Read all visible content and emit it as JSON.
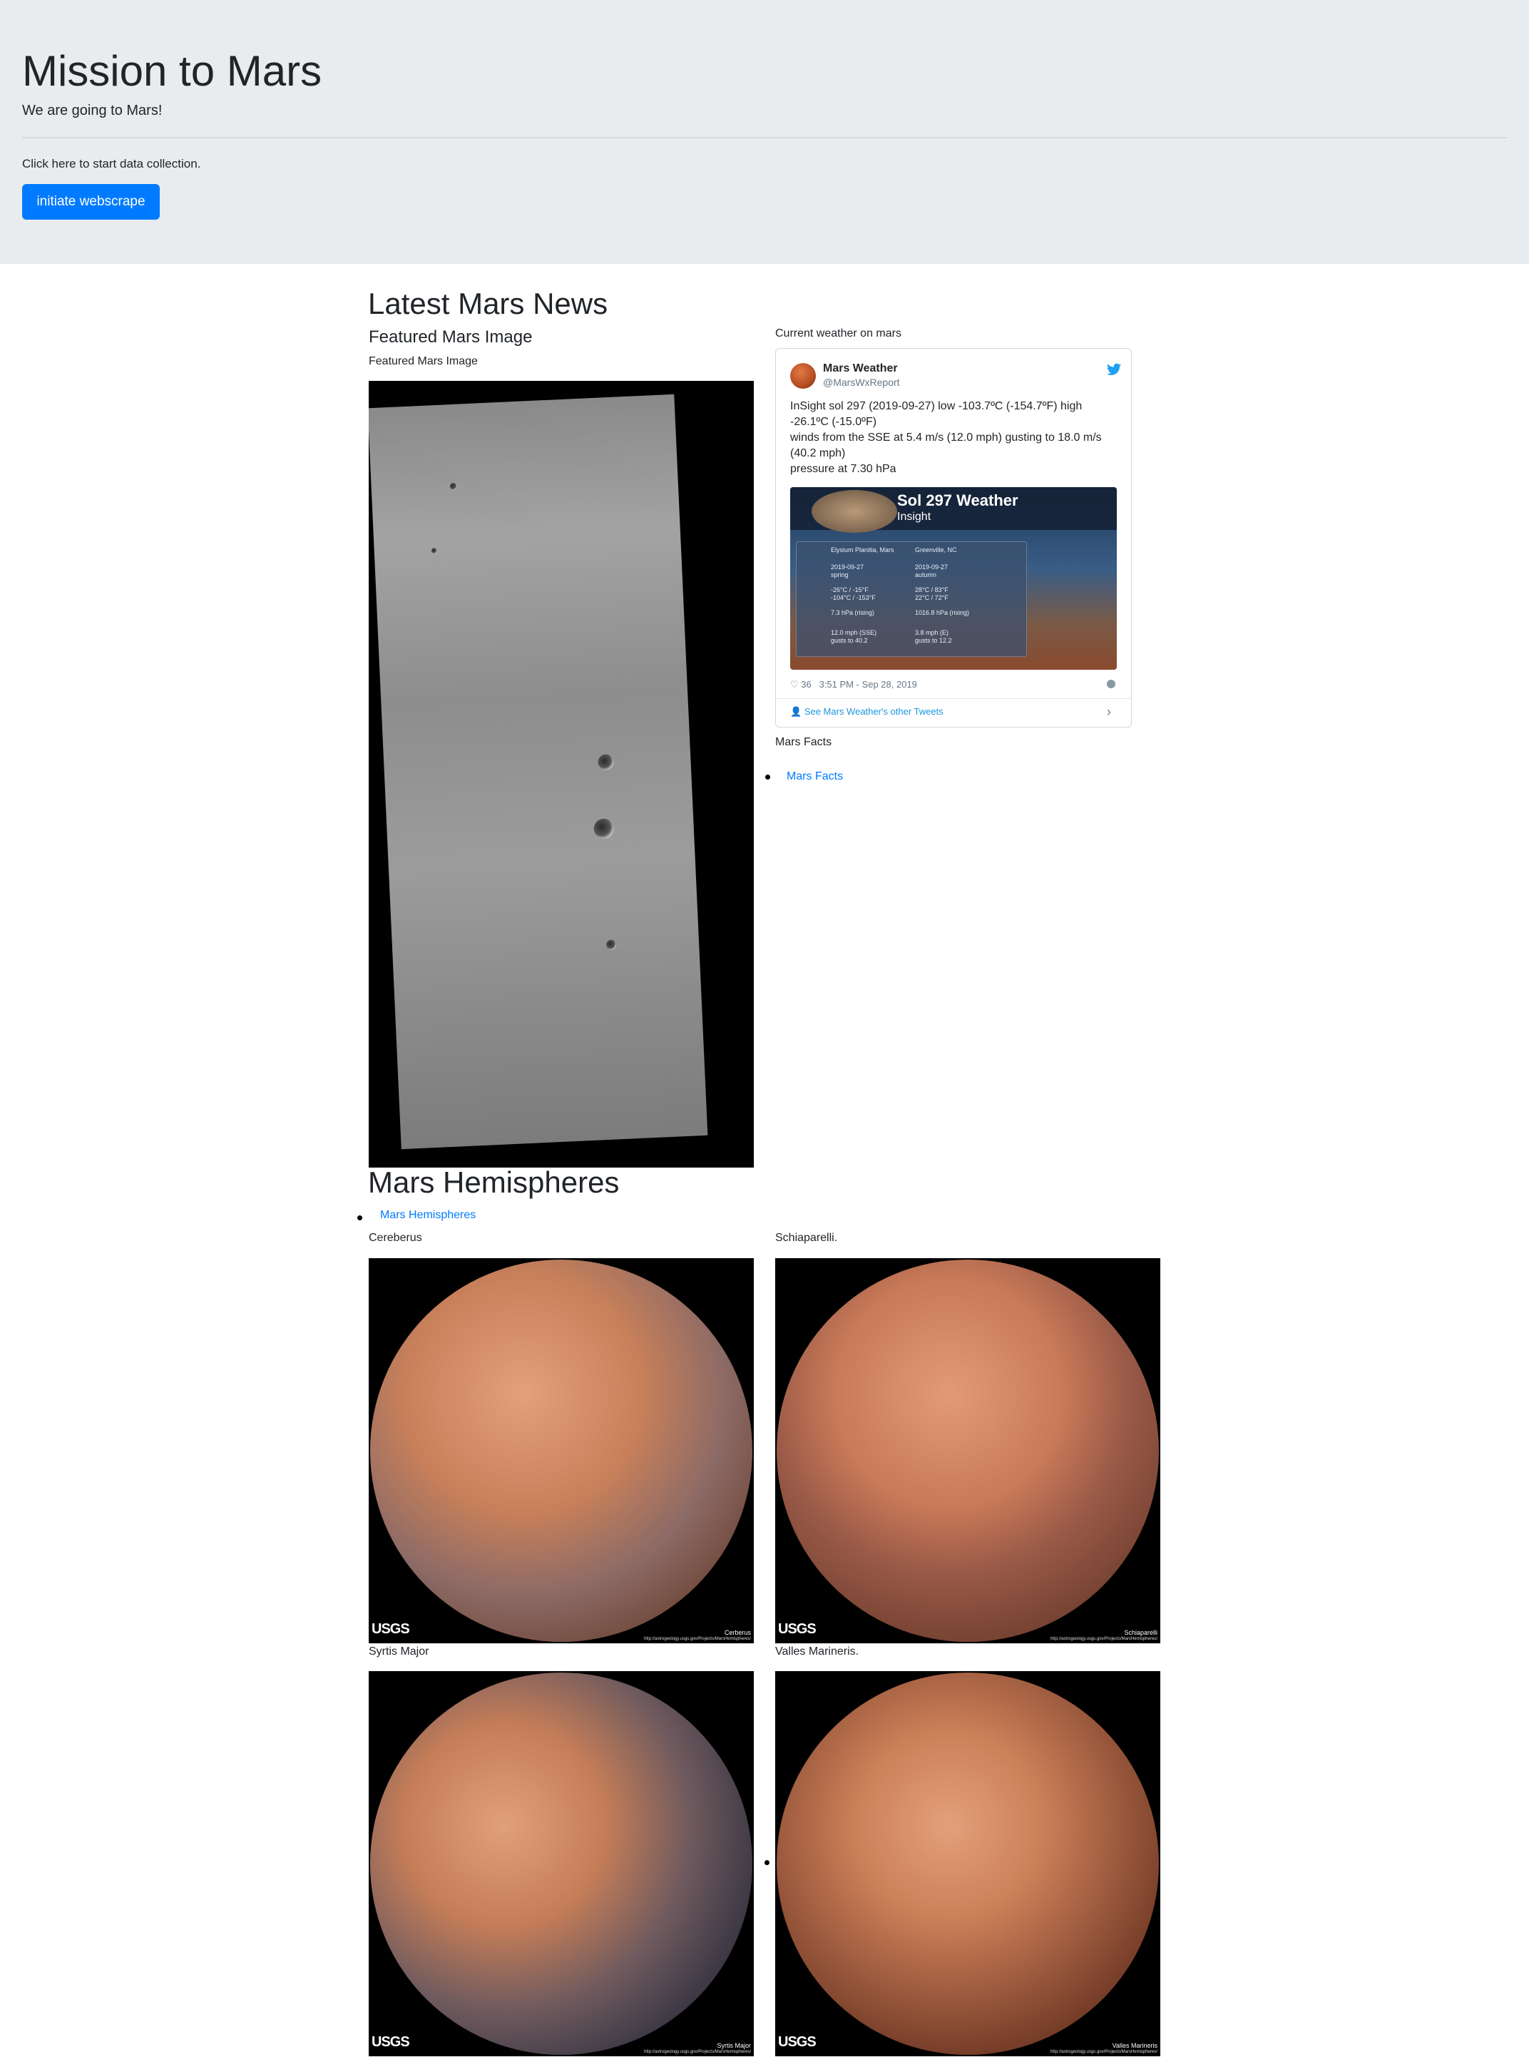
{
  "jumbotron": {
    "title": "Mission to Mars",
    "lead": "We are going to Mars!",
    "note": "Click here to start data collection.",
    "button_label": "initiate webscrape",
    "button_color": "#007bff"
  },
  "news": {
    "heading": "Latest Mars News"
  },
  "featured": {
    "heading": "Featured Mars Image",
    "caption": "Featured Mars Image"
  },
  "weather": {
    "label": "Current weather on mars",
    "tweet": {
      "name": "Mars Weather",
      "handle": "@MarsWxReport",
      "lines": [
        "InSight sol 297 (2019-09-27) low -103.7ºC (-154.7ºF) high",
        "-26.1ºC (-15.0ºF)",
        "winds from the SSE at 5.4 m/s (12.0 mph) gusting to 18.0 m/s",
        "(40.2 mph)",
        "pressure at 7.30 hPa"
      ],
      "media": {
        "title": "Sol 297 Weather",
        "subtitle": "Insight",
        "col1_head": "Elysium Planitia, Mars",
        "col2_head": "Greenville, NC",
        "rows": [
          [
            "2019-09-27",
            "2019-09-27"
          ],
          [
            "spring",
            "autumn"
          ],
          [
            "-26°C / -15°F",
            "28°C / 83°F"
          ],
          [
            "-104°C / -153°F",
            "22°C / 72°F"
          ],
          [
            "7.3 hPa (rising)",
            "1016.8 hPa (rising)"
          ],
          [
            "12.0 mph (SSE)",
            "3.8 mph (E)"
          ],
          [
            "gusts to 40.2",
            "gusts to 12.2"
          ]
        ]
      },
      "likes": "36",
      "timestamp": "3:51 PM - Sep 28, 2019",
      "more": "See Mars Weather's other Tweets",
      "link_color": "#1b95e0"
    }
  },
  "facts": {
    "label": "Mars Facts",
    "link": "Mars Facts"
  },
  "hemispheres": {
    "heading": "Mars Hemispheres",
    "link": "Mars Hemispheres",
    "items": [
      {
        "title": "Cereberus",
        "image_caption": "Cerberus",
        "image_url_text": "http://astrogeology.usgs.gov/Projects/MarsHemispheres/"
      },
      {
        "title": "Schiaparelli.",
        "image_caption": "Schiaparelli",
        "image_url_text": "http://astrogeology.usgs.gov/Projects/MarsHemispheres/"
      },
      {
        "title": "Syrtis Major",
        "image_caption": "Syrtis Major",
        "image_url_text": "http://astrogeology.usgs.gov/Projects/MarsHemispheres/"
      },
      {
        "title": "Valles Marineris.",
        "image_caption": "Valles Marineris",
        "image_url_text": "http://astrogeology.usgs.gov/Projects/MarsHemispheres/"
      }
    ],
    "usgs_label": "USGS"
  }
}
